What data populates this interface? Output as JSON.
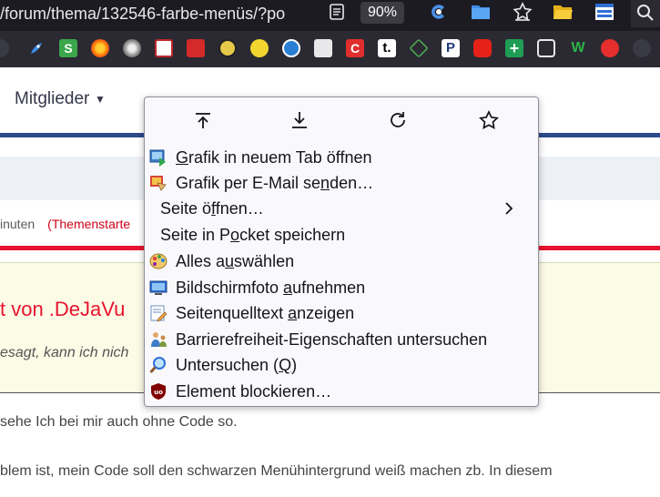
{
  "browser": {
    "url": "/forum/thema/132546-farbe-menüs/?po",
    "zoom": "90%"
  },
  "page": {
    "nav_label": "Mitglieder",
    "meta_fragment": "inuten",
    "meta_starter": "(Themenstarte",
    "quote_title": "t von .DeJaVu",
    "quote_text": "esagt, kann ich nich",
    "body_line1": "sehe Ich bei mir auch ohne Code so.",
    "body_line2": "blem ist, mein Code soll den schwarzen Menühintergrund weiß machen zb. In diesem"
  },
  "context_menu": {
    "items": [
      {
        "pre": "",
        "key": "G",
        "post": "rafik in neuem Tab öffnen",
        "icon": "new-tab-image-icon"
      },
      {
        "pre": "Grafik per E-Mail se",
        "key": "n",
        "post": "den…",
        "icon": "email-image-icon"
      },
      {
        "pre": "Seite ö",
        "key": "f",
        "post": "fnen…",
        "icon": ""
      },
      {
        "pre": "Seite in P",
        "key": "o",
        "post": "cket speichern",
        "icon": ""
      },
      {
        "pre": "Alles a",
        "key": "u",
        "post": "swählen",
        "icon": "palette-icon"
      },
      {
        "pre": "Bildschirmfoto ",
        "key": "a",
        "post": "ufnehmen",
        "icon": "screenshot-icon"
      },
      {
        "pre": "Seitenquelltext ",
        "key": "a",
        "post": "nzeigen",
        "icon": "source-icon"
      },
      {
        "pre": "Barrierefreiheit-Eigenschaften untersuchen",
        "key": "",
        "post": "",
        "icon": "accessibility-icon"
      },
      {
        "pre": "Untersuchen (",
        "key": "Q",
        "post": ")",
        "icon": "inspect-icon"
      },
      {
        "pre": "Element blockieren…",
        "key": "",
        "post": "",
        "icon": "ublock-icon"
      }
    ]
  }
}
